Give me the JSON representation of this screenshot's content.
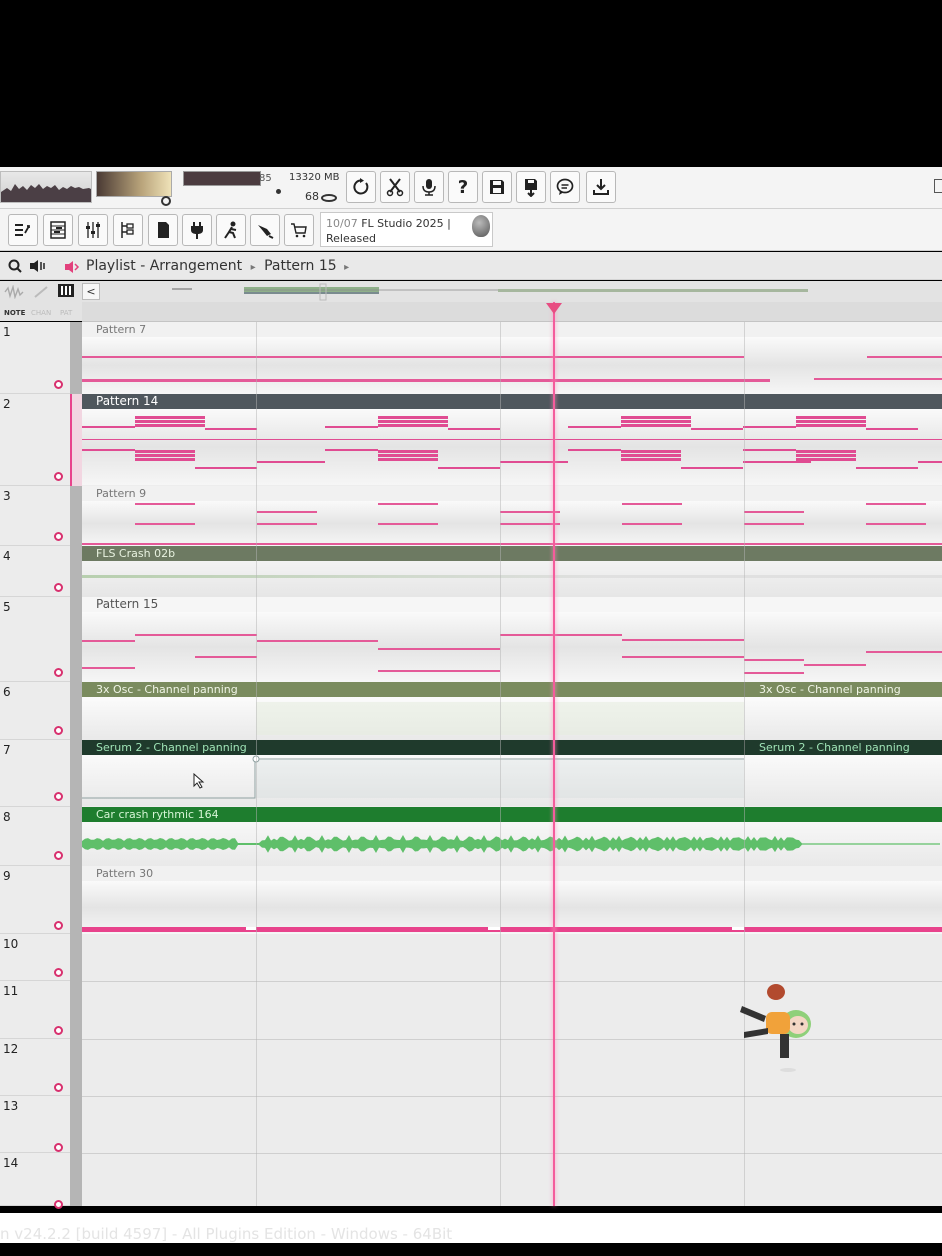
{
  "toolbar": {
    "mem_value": "13320 MB",
    "cpu_value": "68",
    "cpu_prefix": "85",
    "buttons": [
      {
        "icon": "loop-record-icon"
      },
      {
        "icon": "snap-scissors-icon"
      },
      {
        "icon": "microphone-icon"
      },
      {
        "icon": "help-icon",
        "label": "?"
      },
      {
        "icon": "save-icon"
      },
      {
        "icon": "render-icon"
      },
      {
        "icon": "chat-icon"
      },
      {
        "icon": "download-icon"
      }
    ],
    "tools": [
      {
        "icon": "channel-rack-icon"
      },
      {
        "icon": "piano-roll-icon"
      },
      {
        "icon": "mixer-icon"
      },
      {
        "icon": "browser-icon"
      },
      {
        "icon": "project-icon"
      },
      {
        "icon": "plugin-icon"
      },
      {
        "icon": "performance-icon"
      },
      {
        "icon": "tool-icon"
      },
      {
        "icon": "shop-icon"
      }
    ]
  },
  "hint": {
    "line1_date": "10/07",
    "line1_text": "FL Studio 2025 |",
    "line2": "Released"
  },
  "playlist": {
    "title": "Playlist - Arrangement",
    "separator": "▸",
    "pattern": "Pattern 15",
    "mode_tabs": [
      "NOTE",
      "CHAN",
      "PAT"
    ],
    "back": "<"
  },
  "tracks": [
    {
      "num": "1",
      "clip": "Pattern 7"
    },
    {
      "num": "2",
      "clip": "Pattern 14"
    },
    {
      "num": "3",
      "clip": "Pattern 9"
    },
    {
      "num": "4",
      "clip": "FLS Crash 02b"
    },
    {
      "num": "5",
      "clip": "Pattern 15"
    },
    {
      "num": "6",
      "clip": "3x Osc - Channel panning",
      "clip2": "3x Osc - Channel panning"
    },
    {
      "num": "7",
      "clip": "Serum 2 - Channel panning",
      "clip2": "Serum 2 - Channel panning"
    },
    {
      "num": "8",
      "clip": "Car crash rythmic 164"
    },
    {
      "num": "9",
      "clip": "Pattern 30"
    },
    {
      "num": "10"
    },
    {
      "num": "11"
    },
    {
      "num": "12"
    },
    {
      "num": "13"
    },
    {
      "num": "14"
    }
  ],
  "status": "n v24.2.2 [build 4597] - All Plugins Edition - Windows - 64Bit",
  "colors": {
    "accent_pink": "#e8438c",
    "pattern_gray": "#4f575d",
    "automation_olive": "#7a8b5e",
    "automation_dark": "#1f3a2c",
    "audio_green": "#1e7d2e",
    "waveform_green": "#5fbf6a"
  }
}
